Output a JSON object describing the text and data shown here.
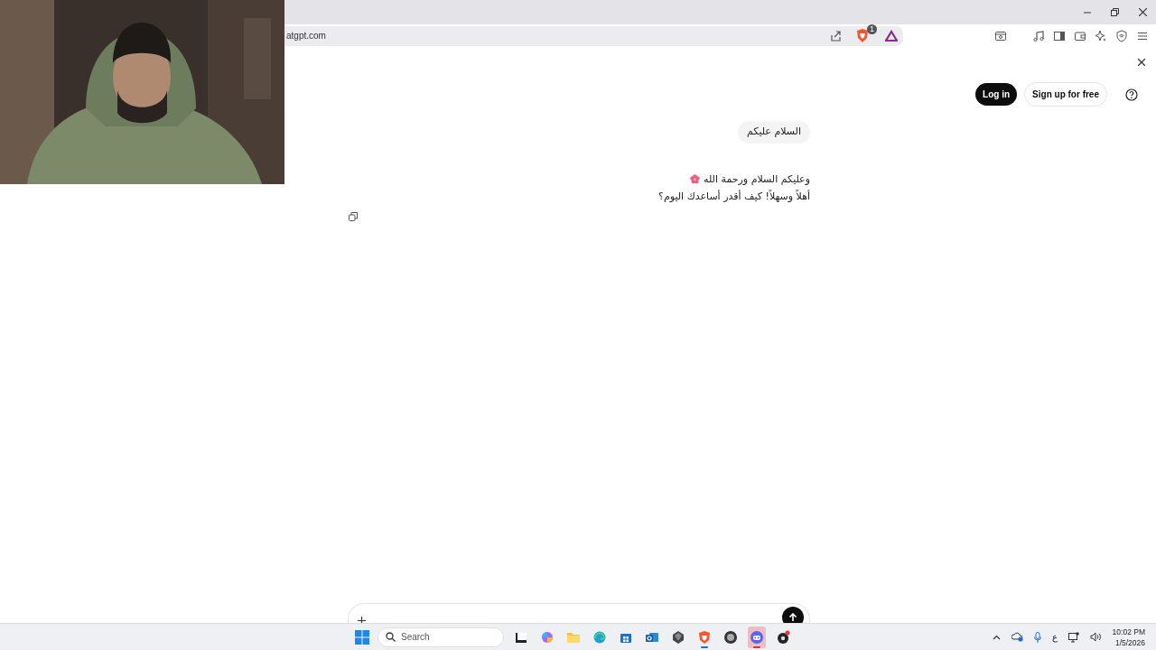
{
  "browser": {
    "url": "atgpt.com",
    "shield_count": "1"
  },
  "header": {
    "login_button": "Log in",
    "signup_button": "Sign up for free"
  },
  "messages": [
    {
      "kind": "user",
      "lines": [
        "السلام عليكم"
      ]
    },
    {
      "kind": "assistant",
      "lines": [
        "وعليكم السلام ورحمة الله",
        "أهلاً وسهلاً! كيف أقدر أساعدك اليوم؟"
      ]
    }
  ],
  "taskbar": {
    "search_placeholder": "Search",
    "apps": [
      {
        "kind": "terminal",
        "open": false,
        "attention": false
      },
      {
        "kind": "copilot",
        "open": false,
        "attention": false
      },
      {
        "kind": "folder",
        "open": false,
        "attention": false
      },
      {
        "kind": "edge",
        "open": false,
        "attention": false
      },
      {
        "kind": "store",
        "open": false,
        "attention": false
      },
      {
        "kind": "outlook",
        "open": false,
        "attention": false
      },
      {
        "kind": "cube",
        "open": false,
        "attention": false
      },
      {
        "kind": "brave",
        "open": true,
        "attention": false
      },
      {
        "kind": "game",
        "open": false,
        "attention": false
      },
      {
        "kind": "discord",
        "open": true,
        "attention": true
      },
      {
        "kind": "chrome",
        "open": false,
        "attention": false
      }
    ],
    "input_language": "ع",
    "time": "10:02 PM",
    "date": "1/5/2026"
  }
}
